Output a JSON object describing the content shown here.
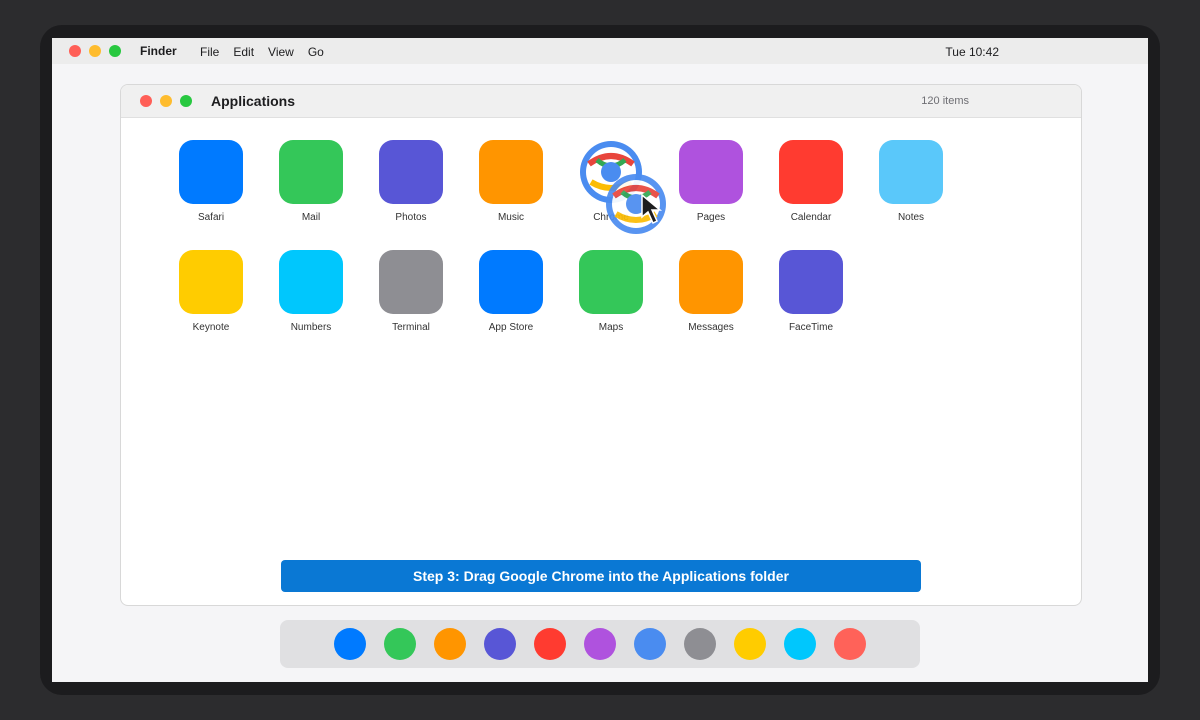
{
  "menubar": {
    "app_name": "Finder",
    "menus": [
      "File",
      "Edit",
      "View",
      "Go"
    ],
    "clock": "Tue 10:42",
    "traffic_colors": [
      "#ff5f57",
      "#febc2e",
      "#28c840"
    ]
  },
  "window": {
    "title": "Applications",
    "item_count": "120 items",
    "apps": [
      {
        "label": "Safari",
        "color": "#007aff"
      },
      {
        "label": "Mail",
        "color": "#34c759"
      },
      {
        "label": "Photos",
        "color": "#5856d6"
      },
      {
        "label": "Music",
        "color": "#ff9500"
      },
      {
        "label": "Chrome",
        "color": "chrome"
      },
      {
        "label": "Pages",
        "color": "#af52de"
      },
      {
        "label": "Calendar",
        "color": "#ff3b30"
      },
      {
        "label": "Notes",
        "color": "#5ac8fa"
      },
      {
        "label": "Keynote",
        "color": "#ffcc00"
      },
      {
        "label": "Numbers",
        "color": "#00c7fd"
      },
      {
        "label": "Terminal",
        "color": "#8e8e93"
      },
      {
        "label": "App Store",
        "color": "#007aff"
      },
      {
        "label": "Maps",
        "color": "#34c759"
      },
      {
        "label": "Messages",
        "color": "#ff9500"
      },
      {
        "label": "FaceTime",
        "color": "#5856d6"
      }
    ]
  },
  "instruction_banner": "Step 3: Drag Google Chrome into the Applications folder",
  "dock": {
    "icons": [
      "#007aff",
      "#34c759",
      "#ff9500",
      "#5856d6",
      "#ff3b30",
      "#af52de",
      "#4a8cf0",
      "#8e8e93",
      "#ffcc00",
      "#00c7fd",
      "#ff6259"
    ]
  }
}
